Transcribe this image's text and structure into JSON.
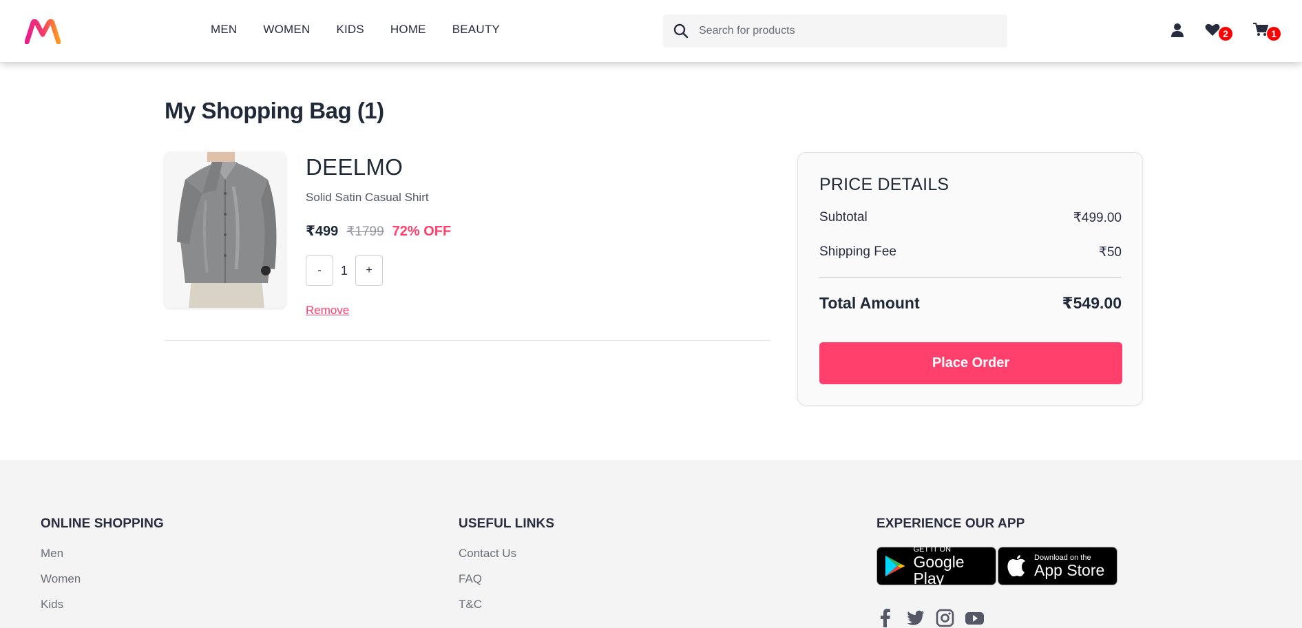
{
  "header": {
    "nav": [
      "MEN",
      "WOMEN",
      "KIDS",
      "HOME",
      "BEAUTY"
    ],
    "search_placeholder": "Search for products",
    "wishlist_count": "2",
    "cart_count": "1"
  },
  "bag": {
    "title": "My Shopping Bag (1)",
    "item": {
      "brand": "DEELMO",
      "name": "Solid Satin Casual Shirt",
      "price": "₹499",
      "mrp": "₹1799",
      "discount": "72% OFF",
      "quantity": "1",
      "minus_label": "-",
      "plus_label": "+",
      "remove_label": "Remove"
    }
  },
  "price_details": {
    "title": "PRICE DETAILS",
    "subtotal_label": "Subtotal",
    "subtotal_value": "₹499.00",
    "shipping_label": "Shipping Fee",
    "shipping_value": "₹50",
    "total_label": "Total Amount",
    "total_value": "₹549.00",
    "button_label": "Place Order"
  },
  "footer": {
    "online_shopping": {
      "title": "ONLINE SHOPPING",
      "links": [
        "Men",
        "Women",
        "Kids"
      ]
    },
    "useful_links": {
      "title": "USEFUL LINKS",
      "links": [
        "Contact Us",
        "FAQ",
        "T&C"
      ]
    },
    "app": {
      "title": "EXPERIENCE OUR APP",
      "google_small": "GET IT ON",
      "google_big": "Google Play",
      "apple_small": "Download on the",
      "apple_big": "App Store"
    }
  },
  "colors": {
    "accent": "#ff3f6c",
    "badge": "#ff0000",
    "footer_bg": "#f4f4f4"
  }
}
